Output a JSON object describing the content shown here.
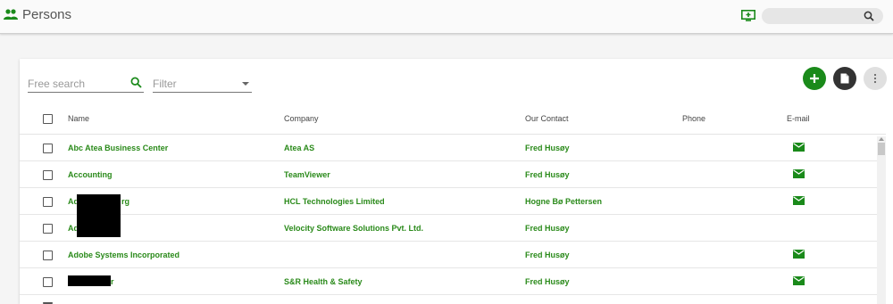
{
  "header": {
    "title": "Persons",
    "global_search": {
      "placeholder": "",
      "value": ""
    }
  },
  "toolbar": {
    "free_search_placeholder": "Free search",
    "filter_label": "Filter"
  },
  "table": {
    "columns": [
      "Name",
      "Company",
      "Our Contact",
      "Phone",
      "E-mail"
    ],
    "rows": [
      {
        "name": "Abc Atea Business Center",
        "company": "Atea AS",
        "contact": "Fred Husøy",
        "phone": "",
        "email": true
      },
      {
        "name": "Accounting",
        "company": "TeamViewer",
        "contact": "Fred Husøy",
        "phone": "",
        "email": true
      },
      {
        "name": "Ad",
        "name_suffix": "rg",
        "company": "HCL Technologies Limited",
        "contact": "Hogne Bø Pettersen",
        "phone": "",
        "email": true
      },
      {
        "name": "Ad",
        "company": "Velocity Software Solutions Pvt. Ltd.",
        "contact": "Fred Husøy",
        "phone": "",
        "email": false
      },
      {
        "name": "Adobe Systems Incorporated",
        "company": "",
        "contact": "Fred Husøy",
        "phone": "",
        "email": true
      },
      {
        "name": "",
        "name_suffix": "r",
        "company": "S&R Health & Safety",
        "contact": "Fred Husøy",
        "phone": "",
        "email": true
      }
    ]
  },
  "colors": {
    "accent": "#2a8a1a",
    "add_button": "#1a8a1a",
    "doc_button": "#333333",
    "more_button": "#e0e0e0"
  },
  "icons": {
    "header": "people-icon",
    "monitor": "monitor-add-icon",
    "search": "search-icon",
    "add": "plus-icon",
    "document": "document-icon",
    "more": "more-vertical-icon",
    "email": "envelope-icon"
  }
}
